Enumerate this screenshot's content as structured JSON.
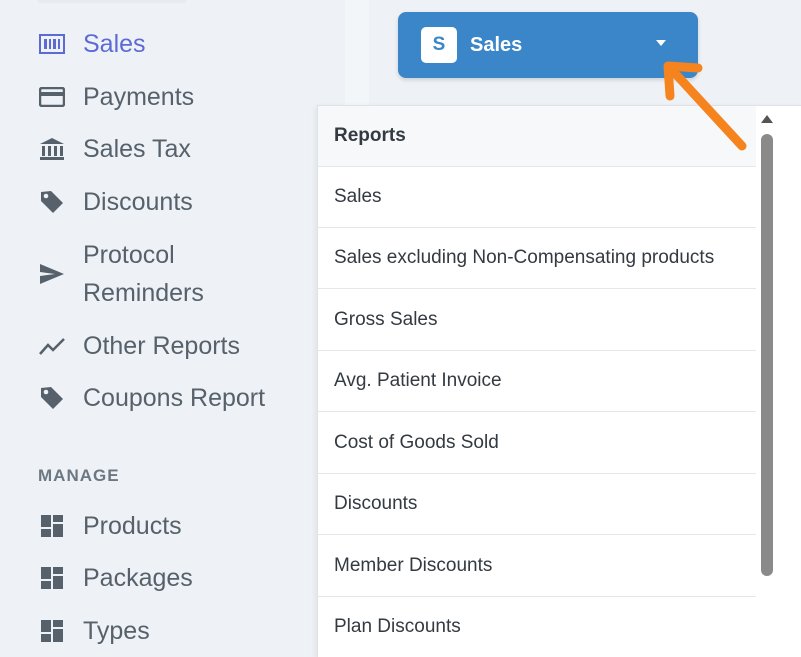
{
  "sidebar": {
    "items": [
      {
        "label": "Sales",
        "icon": "cash-register-icon",
        "active": true
      },
      {
        "label": "Payments",
        "icon": "credit-card-icon",
        "active": false
      },
      {
        "label": "Sales Tax",
        "icon": "bank-icon",
        "active": false
      },
      {
        "label": "Discounts",
        "icon": "tag-icon",
        "active": false
      },
      {
        "label": "Protocol",
        "label2": "Reminders",
        "icon": "send-icon",
        "active": false
      },
      {
        "label": "Other Reports",
        "icon": "trend-line-icon",
        "active": false
      },
      {
        "label": "Coupons Report",
        "icon": "tag-icon",
        "active": false
      }
    ],
    "manage_heading": "MANAGE",
    "manage_items": [
      {
        "label": "Products",
        "icon": "dashboard-icon"
      },
      {
        "label": "Packages",
        "icon": "dashboard-icon"
      },
      {
        "label": "Types",
        "icon": "dashboard-icon"
      }
    ]
  },
  "sales_button": {
    "badge": "S",
    "label": "Sales",
    "icon": "caret-down-icon"
  },
  "menu": {
    "header": "Reports",
    "items": [
      "Sales",
      "Sales excluding Non-Compensating products",
      "Gross Sales",
      "Avg. Patient Invoice",
      "Cost of Goods Sold",
      "Discounts",
      "Member Discounts",
      "Plan Discounts"
    ]
  },
  "colors": {
    "accent": "#3a86c8",
    "active_nav": "#5c6bd4",
    "nav_text": "#56616b",
    "annotation_arrow": "#f5841f"
  }
}
